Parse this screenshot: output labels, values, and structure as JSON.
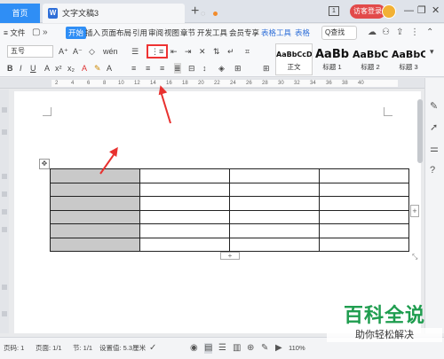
{
  "tabs": {
    "home": "首页",
    "doc_name": "文字文稿3",
    "new_tab": "+"
  },
  "title_right": {
    "badge": "1",
    "visitor": "访客登录",
    "minimize": "—",
    "restore": "❐",
    "close": "✕"
  },
  "menu": {
    "file": "≡ 文件",
    "items": [
      "开始",
      "插入",
      "页面布局",
      "引用",
      "审阅",
      "视图",
      "章节",
      "开发工具",
      "会员专享",
      "表格工具",
      "表格"
    ],
    "search": "Q查找"
  },
  "ribbon": {
    "font_size": "五号",
    "styles": [
      {
        "sample": "AaBbCcDd",
        "label": "正文"
      },
      {
        "sample": "AaBb",
        "label": "标题 1"
      },
      {
        "sample": "AaBbC",
        "label": "标题 2"
      },
      {
        "sample": "AaBbC",
        "label": "标题 3"
      }
    ]
  },
  "ruler": {
    "ticks": [
      "2",
      "4",
      "6",
      "8",
      "10",
      "12",
      "14",
      "16",
      "18",
      "20",
      "22",
      "24",
      "26",
      "28",
      "30",
      "32",
      "34",
      "36",
      "38",
      "40"
    ]
  },
  "table": {
    "rows": 6,
    "cols": 4
  },
  "status": {
    "page_label": "页码: 1",
    "pages": "页面: 1/1",
    "section": "节: 1/1",
    "setting": "设置值: 5.3厘米",
    "zoom": "110%"
  },
  "watermark": {
    "title": "百科全说",
    "subtitle": "助你轻松解决"
  },
  "colors": {
    "accent": "#2f8ef5",
    "arrow": "#e8312f",
    "watermark": "#1f9d4f",
    "selected_cell": "#c9c9c9"
  }
}
